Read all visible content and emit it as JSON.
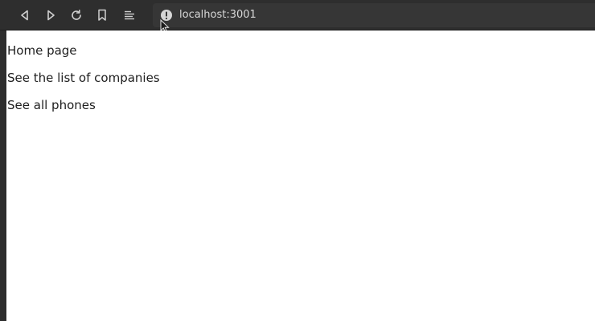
{
  "browser": {
    "url": "localhost:3001",
    "icons": [
      "back-icon",
      "forward-icon",
      "reload-icon",
      "bookmark-icon",
      "reader-icon",
      "site-info-icon"
    ]
  },
  "page": {
    "links": [
      {
        "label": "Home page"
      },
      {
        "label": "See the list of companies"
      },
      {
        "label": "See all phones"
      }
    ]
  },
  "colors": {
    "toolbar_bg": "#2e2e2e",
    "urlbar_bg": "#363636",
    "content_bg": "#ffffff",
    "text": "#1e1e1e",
    "toolbar_icon": "#d0d0d0"
  }
}
